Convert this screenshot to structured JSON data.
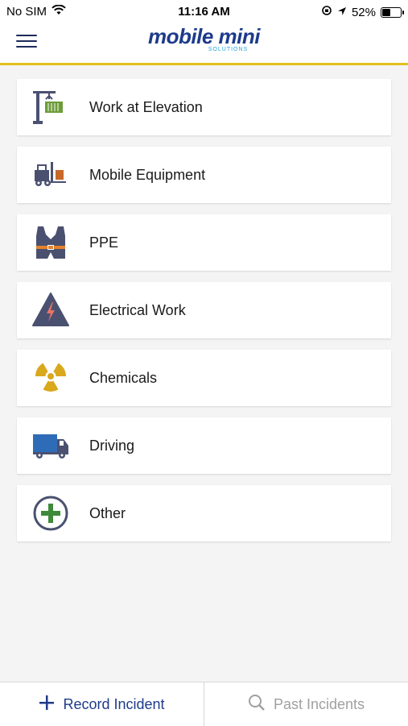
{
  "status": {
    "carrier": "No SIM",
    "time": "11:16 AM",
    "battery": "52%",
    "battery_level": 0.52
  },
  "header": {
    "logo_text": "mobile mini",
    "logo_sub": "SOLUTIONS",
    "accent": "#e3c01f"
  },
  "categories": [
    {
      "label": "Work at Elevation",
      "icon": "crane-icon"
    },
    {
      "label": "Mobile Equipment",
      "icon": "forklift-icon"
    },
    {
      "label": "PPE",
      "icon": "vest-icon"
    },
    {
      "label": "Electrical Work",
      "icon": "electrical-warning-icon"
    },
    {
      "label": "Chemicals",
      "icon": "radiation-icon"
    },
    {
      "label": "Driving",
      "icon": "truck-icon"
    },
    {
      "label": "Other",
      "icon": "plus-circle-icon"
    }
  ],
  "bottom_nav": {
    "record_label": "Record Incident",
    "past_label": "Past Incidents"
  }
}
